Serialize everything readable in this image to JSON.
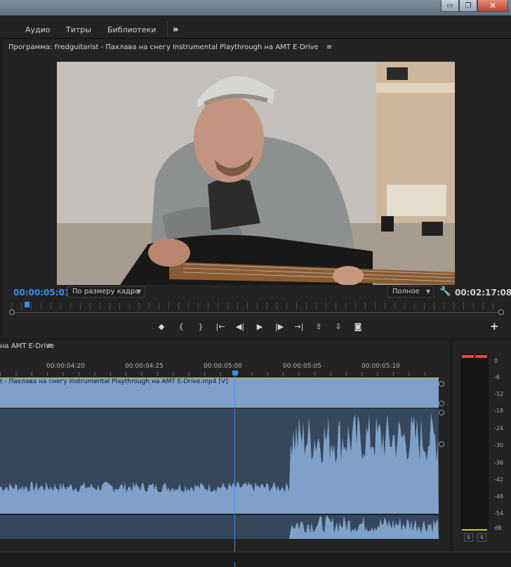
{
  "workspace": {
    "tabs": [
      "Аудио",
      "Титры",
      "Библиотеки"
    ],
    "more": "»"
  },
  "window_controls": {
    "minimize": "▭",
    "restore": "❐",
    "close": "✕"
  },
  "program_monitor": {
    "title": "Программа: Fredguitarist - Пахлава на снегу Instrumental Playthrough на AMT E-Drive",
    "menu_icon": "≡",
    "current_timecode": "00:00:05:01",
    "fit": "По размеру кадра",
    "quality": "Полное",
    "duration": "00:02:17:08",
    "playhead_fraction": 0.037,
    "transport": [
      "mark-in-icon",
      "in-bracket-icon",
      "out-bracket-icon",
      "go-to-in-icon",
      "step-back-icon",
      "play-icon",
      "step-forward-icon",
      "go-to-out-icon",
      "lift-icon",
      "extract-icon",
      "export-frame-icon"
    ],
    "transport_glyphs": [
      "◆",
      "{",
      "}",
      "|←",
      "◀|",
      "▶",
      "|▶",
      "→|",
      "⇪",
      "⇩",
      "◙"
    ],
    "add_button": "+"
  },
  "timeline": {
    "title": "на AMT E-Drive",
    "menu_icon": "≡",
    "ticks": [
      "00:00:04:20",
      "00:00:04:25",
      "00:00:05:00",
      "00:00:05:05",
      "00:00:05:10"
    ],
    "video_clip_label": "t - Пахлава на снегу Instrumental Playthrough на AMT E-Drive.mp4 [V]"
  },
  "audio_meter": {
    "scale": [
      "0",
      "-6",
      "-12",
      "-18",
      "-24",
      "-30",
      "-36",
      "-42",
      "-48",
      "-54",
      "dB"
    ],
    "solo_labels": [
      "S",
      "S"
    ]
  },
  "colors": {
    "accent": "#3b8ee8",
    "clip_video": "#7fa1c9",
    "clip_audio": "#36475c",
    "peak": "#e04444"
  }
}
